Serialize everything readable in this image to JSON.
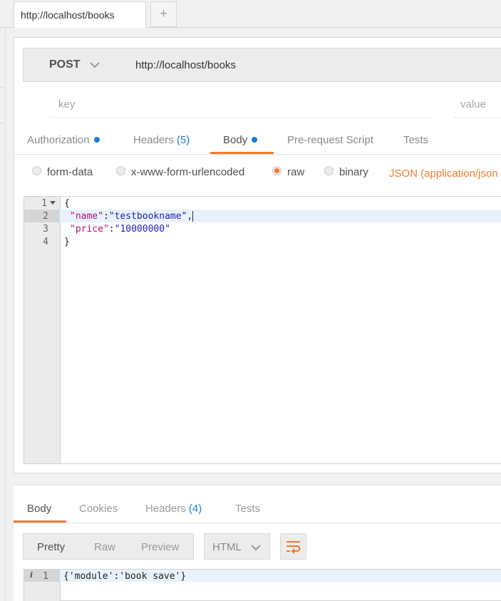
{
  "tabs": {
    "active_label": "http://localhost/books",
    "add_label": "+"
  },
  "request": {
    "method": "POST",
    "url": "http://localhost/books",
    "params": {
      "key_placeholder": "key",
      "value_placeholder": "value"
    },
    "tabs": [
      {
        "label": "Authorization",
        "indicator": "dot"
      },
      {
        "label": "Headers",
        "count": "(5)"
      },
      {
        "label": "Body",
        "indicator": "dot",
        "active": true
      },
      {
        "label": "Pre-request Script"
      },
      {
        "label": "Tests"
      }
    ],
    "body_modes": [
      {
        "label": "form-data",
        "selected": false
      },
      {
        "label": "x-www-form-urlencoded",
        "selected": false
      },
      {
        "label": "raw",
        "selected": true
      },
      {
        "label": "binary",
        "selected": false
      }
    ],
    "content_type": "JSON (application/json",
    "editor": {
      "line_numbers": [
        "1",
        "2",
        "3",
        "4"
      ],
      "line1": "{",
      "line2_key": "\"name\"",
      "line2_value": "\"testbookname\"",
      "line3_key": "\"price\"",
      "line3_value": "\"10000000\"",
      "line4": "}",
      "colon": ":",
      "comma": ","
    }
  },
  "response": {
    "tabs": [
      {
        "label": "Body",
        "active": true
      },
      {
        "label": "Cookies"
      },
      {
        "label": "Headers",
        "count": "(4)"
      },
      {
        "label": "Tests"
      }
    ],
    "views": [
      "Pretty",
      "Raw",
      "Preview"
    ],
    "active_view": "Pretty",
    "format": "HTML",
    "editor": {
      "line_number": "1",
      "info": "i",
      "content": "{'module':'book save'}"
    }
  },
  "colors": {
    "accent": "#f07a2c",
    "link_blue": "#1f7dcf",
    "code_key": "#b3137a",
    "code_string": "#2323b5"
  },
  "icons": [
    "chevron-down-icon",
    "wrap-lines-icon",
    "fold-arrow-icon",
    "info-icon"
  ]
}
